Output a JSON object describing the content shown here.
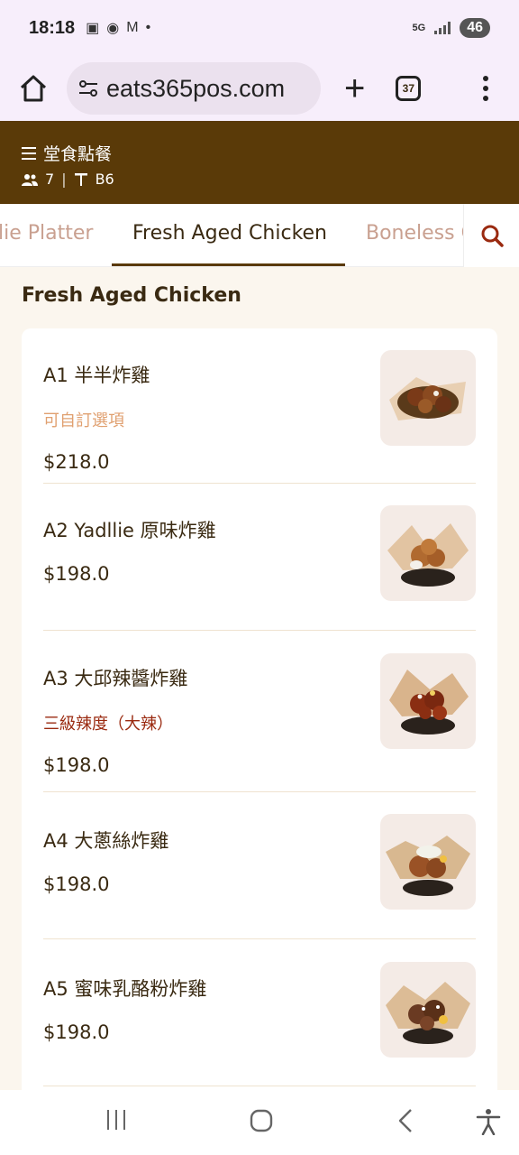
{
  "status": {
    "time": "18:18",
    "network": "5G",
    "battery": "46"
  },
  "browser": {
    "url": "eats365pos.com",
    "tab_count": "37"
  },
  "header": {
    "title": "堂食點餐",
    "guests": "7",
    "table": "B6"
  },
  "categories": [
    {
      "label": "lie Platter",
      "active": false
    },
    {
      "label": "Fresh Aged Chicken",
      "active": true
    },
    {
      "label": "Boneless C",
      "active": false
    }
  ],
  "section": {
    "title": "Fresh Aged Chicken"
  },
  "items": [
    {
      "name": "A1 半半炸雞",
      "option": "可自訂選項",
      "option_color": "#e0a070",
      "price": "$218.0"
    },
    {
      "name": "A2 Yadllie 原味炸雞",
      "option": "",
      "price": "$198.0"
    },
    {
      "name": "A3 大邱辣醬炸雞",
      "option": "三級辣度（大辣）",
      "option_color": "#9a2a10",
      "price": "$198.0"
    },
    {
      "name": "A4 大蔥絲炸雞",
      "option": "",
      "price": "$198.0"
    },
    {
      "name": "A5 蜜味乳酪粉炸雞",
      "option": "",
      "price": "$198.0"
    }
  ],
  "colors": {
    "brand": "#5a3a08",
    "accent": "#9a2a10",
    "muted": "#c9a090"
  }
}
